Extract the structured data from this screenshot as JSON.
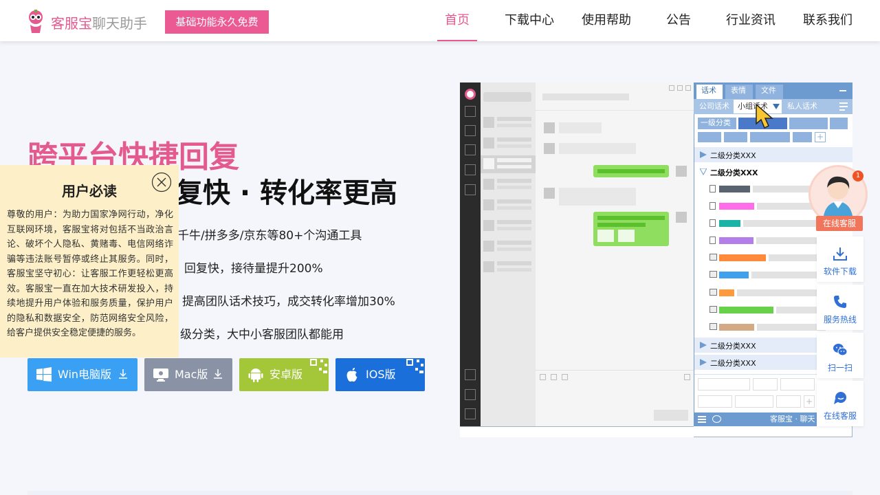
{
  "header": {
    "brand_main": "客服宝",
    "brand_sub": "聊天助手",
    "free_badge": "基础功能永久免费",
    "nav": [
      "首页",
      "下载中心",
      "使用帮助",
      "公告",
      "行业资讯",
      "联系我们"
    ],
    "active_nav": "首页"
  },
  "hero": {
    "title": "跨平台快捷回复",
    "subtitle_visible": "复快 · 转化率更高",
    "features": [
      "千牛/拼多多/京东等80+个沟通工具",
      "回复快，接待量提升200%",
      "提高团队话术技巧，成交转化率增加30%",
      "级分类，大中小客服团队都能用"
    ]
  },
  "downloads": {
    "win": "Win电脑版",
    "mac": "Mac版",
    "android": "安卓版",
    "ios": "IOS版"
  },
  "notice": {
    "title": "用户必读",
    "body": "尊敬的用户：为助力国家净网行动，净化互联网环境，客服宝将对包括不当政治言论、破坏个人隐私、黄赌毒、电信网络诈骗等违法账号暂停或终止其服务。同时，客服宝坚守初心：让客服工作更轻松更高效。客服宝一直在加大技术研发投入，持续地提升用户体验和服务质量，保护用户的隐私和数据安全，防范网络安全风险，给客户提供安全稳定便捷的服务。"
  },
  "mockup": {
    "tabs": [
      "话术",
      "表情",
      "文件"
    ],
    "subtabs": [
      "公司话术",
      "小组话术",
      "私人话术"
    ],
    "level1": "一级分类",
    "level2": [
      "二级分类XXX",
      "二级分类XXX",
      "二级分类XXX",
      "二级分类XXX"
    ],
    "footer": "客服宝 · 聊天"
  },
  "float_bar": {
    "badge": "1",
    "online_tag": "在线客服",
    "items": [
      "软件下载",
      "服务热线",
      "扫一扫",
      "在线客服"
    ]
  },
  "colors": {
    "brand_pink": "#e45a8f",
    "win": "#3aa0f3",
    "mac": "#8a93a6",
    "android": "#a4c639",
    "ios": "#1a6fdb",
    "accent_blue": "#2f6fd6"
  }
}
